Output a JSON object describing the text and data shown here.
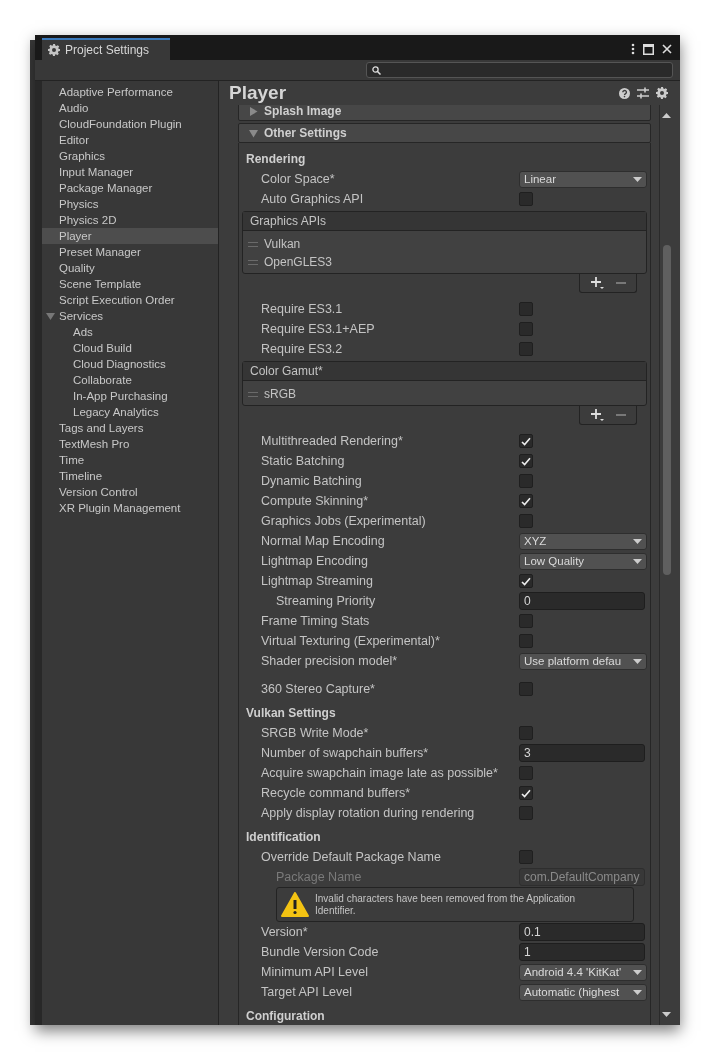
{
  "window": {
    "tab_title": "Project Settings"
  },
  "sidebar": {
    "items": [
      {
        "label": "Adaptive Performance",
        "selected": false
      },
      {
        "label": "Audio",
        "selected": false
      },
      {
        "label": "CloudFoundation Plugin",
        "selected": false
      },
      {
        "label": "Editor",
        "selected": false
      },
      {
        "label": "Graphics",
        "selected": false
      },
      {
        "label": "Input Manager",
        "selected": false
      },
      {
        "label": "Package Manager",
        "selected": false
      },
      {
        "label": "Physics",
        "selected": false
      },
      {
        "label": "Physics 2D",
        "selected": false
      },
      {
        "label": "Player",
        "selected": true
      },
      {
        "label": "Preset Manager",
        "selected": false
      },
      {
        "label": "Quality",
        "selected": false
      },
      {
        "label": "Scene Template",
        "selected": false
      },
      {
        "label": "Script Execution Order",
        "selected": false
      },
      {
        "label": "Services",
        "selected": false,
        "expanded": true,
        "children": [
          {
            "label": "Ads",
            "selected": false
          },
          {
            "label": "Cloud Build",
            "selected": false
          },
          {
            "label": "Cloud Diagnostics",
            "selected": false
          },
          {
            "label": "Collaborate",
            "selected": false
          },
          {
            "label": "In-App Purchasing",
            "selected": false
          },
          {
            "label": "Legacy Analytics",
            "selected": false
          }
        ]
      },
      {
        "label": "Tags and Layers",
        "selected": false
      },
      {
        "label": "TextMesh Pro",
        "selected": false
      },
      {
        "label": "Time",
        "selected": false
      },
      {
        "label": "Timeline",
        "selected": false
      },
      {
        "label": "Version Control",
        "selected": false
      },
      {
        "label": "XR Plugin Management",
        "selected": false
      }
    ]
  },
  "inspector": {
    "title": "Player",
    "sections": [
      {
        "title": "Splash Image",
        "expanded": false
      },
      {
        "title": "Other Settings",
        "expanded": true
      }
    ],
    "rows": [
      {
        "kind": "group",
        "label": "Rendering"
      },
      {
        "kind": "dropdown",
        "label": "Color Space*",
        "value": "Linear"
      },
      {
        "kind": "checkbox",
        "label": "Auto Graphics API",
        "checked": false
      },
      {
        "kind": "list",
        "label": "Graphics APIs",
        "items": [
          "Vulkan",
          "OpenGLES3"
        ]
      },
      {
        "kind": "checkbox",
        "label": "Require ES3.1",
        "checked": false
      },
      {
        "kind": "checkbox",
        "label": "Require ES3.1+AEP",
        "checked": false
      },
      {
        "kind": "checkbox",
        "label": "Require ES3.2",
        "checked": false
      },
      {
        "kind": "list",
        "label": "Color Gamut*",
        "items": [
          "sRGB"
        ]
      },
      {
        "kind": "checkbox",
        "label": "Multithreaded Rendering*",
        "checked": true
      },
      {
        "kind": "checkbox",
        "label": "Static Batching",
        "checked": true
      },
      {
        "kind": "checkbox",
        "label": "Dynamic Batching",
        "checked": false
      },
      {
        "kind": "checkbox",
        "label": "Compute Skinning*",
        "checked": true
      },
      {
        "kind": "checkbox",
        "label": "Graphics Jobs (Experimental)",
        "checked": false
      },
      {
        "kind": "dropdown",
        "label": "Normal Map Encoding",
        "value": "XYZ"
      },
      {
        "kind": "dropdown",
        "label": "Lightmap Encoding",
        "value": "Low Quality"
      },
      {
        "kind": "checkbox",
        "label": "Lightmap Streaming",
        "checked": true,
        "children": [
          {
            "kind": "field",
            "label": "Streaming Priority",
            "value": "0",
            "disabled": false
          }
        ]
      },
      {
        "kind": "checkbox",
        "label": "Frame Timing Stats",
        "checked": false
      },
      {
        "kind": "checkbox",
        "label": "Virtual Texturing (Experimental)*",
        "checked": false
      },
      {
        "kind": "dropdown",
        "label": "Shader precision model*",
        "value": "Use platform defau"
      },
      {
        "kind": "checkbox",
        "label": "360 Stereo Capture*",
        "checked": false
      },
      {
        "kind": "group",
        "label": "Vulkan Settings"
      },
      {
        "kind": "checkbox",
        "label": "SRGB Write Mode*",
        "checked": false
      },
      {
        "kind": "field",
        "label": "Number of swapchain buffers*",
        "value": "3",
        "disabled": false
      },
      {
        "kind": "checkbox",
        "label": "Acquire swapchain image late as possible*",
        "checked": false
      },
      {
        "kind": "checkbox",
        "label": "Recycle command buffers*",
        "checked": true
      },
      {
        "kind": "checkbox",
        "label": "Apply display rotation during rendering",
        "checked": false
      },
      {
        "kind": "group",
        "label": "Identification"
      },
      {
        "kind": "checkbox",
        "label": "Override Default Package Name",
        "checked": false,
        "children": [
          {
            "kind": "field",
            "label": "Package Name",
            "value": "com.DefaultCompany",
            "disabled": true
          },
          {
            "kind": "warning",
            "text": "Invalid characters have been removed from the Application Identifier."
          }
        ]
      },
      {
        "kind": "field",
        "label": "Version*",
        "value": "0.1",
        "disabled": false
      },
      {
        "kind": "field",
        "label": "Bundle Version Code",
        "value": "1",
        "disabled": false
      },
      {
        "kind": "dropdown",
        "label": "Minimum API Level",
        "value": "Android 4.4 'KitKat'"
      },
      {
        "kind": "dropdown",
        "label": "Target API Level",
        "value": "Automatic (highest"
      },
      {
        "kind": "group",
        "label": "Configuration"
      }
    ]
  }
}
